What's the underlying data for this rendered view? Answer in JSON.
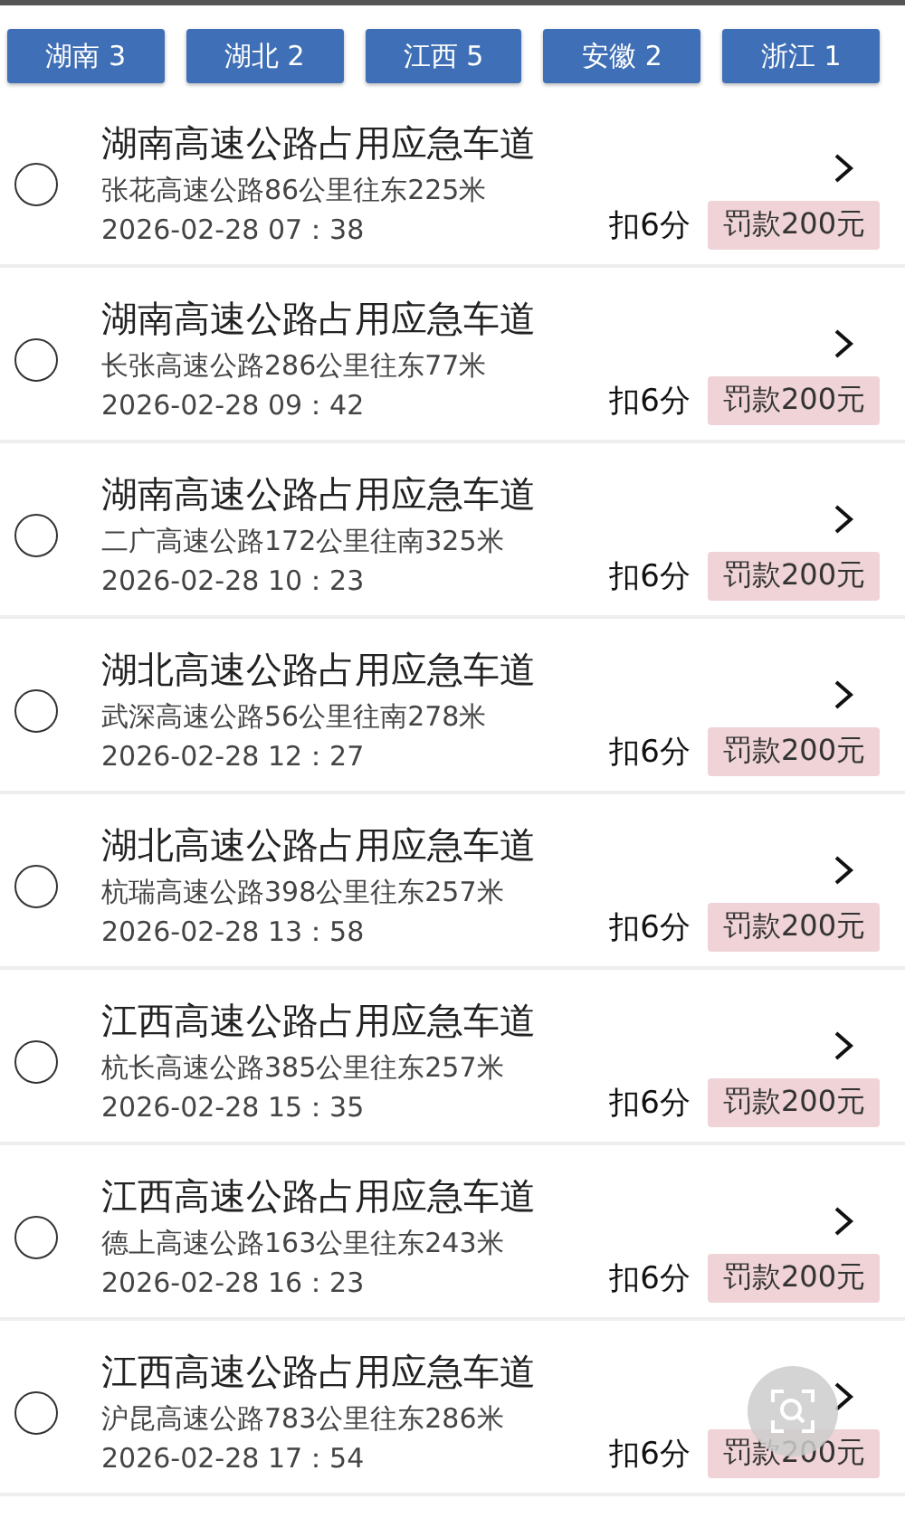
{
  "tabs": [
    {
      "label": "湖南 3"
    },
    {
      "label": "湖北 2"
    },
    {
      "label": "江西 5"
    },
    {
      "label": "安徽 2"
    },
    {
      "label": "浙江 1"
    }
  ],
  "violations": [
    {
      "title": "湖南高速公路占用应急车道",
      "location": "张花高速公路86公里往东225米",
      "time": "2026-02-28  07：38",
      "points": "扣6分",
      "fine": "罚款200元",
      "selected": false
    },
    {
      "title": "湖南高速公路占用应急车道",
      "location": "长张高速公路286公里往东77米",
      "time": "2026-02-28  09：42",
      "points": "扣6分",
      "fine": "罚款200元",
      "selected": false
    },
    {
      "title": "湖南高速公路占用应急车道",
      "location": "二广高速公路172公里往南325米",
      "time": "2026-02-28  10：23",
      "points": "扣6分",
      "fine": "罚款200元",
      "selected": false
    },
    {
      "title": "湖北高速公路占用应急车道",
      "location": "武深高速公路56公里往南278米",
      "time": "2026-02-28  12：27",
      "points": "扣6分",
      "fine": "罚款200元",
      "selected": false
    },
    {
      "title": "湖北高速公路占用应急车道",
      "location": "杭瑞高速公路398公里往东257米",
      "time": "2026-02-28  13：58",
      "points": "扣6分",
      "fine": "罚款200元",
      "selected": false
    },
    {
      "title": "江西高速公路占用应急车道",
      "location": "杭长高速公路385公里往东257米",
      "time": "2026-02-28  15：35",
      "points": "扣6分",
      "fine": "罚款200元",
      "selected": false
    },
    {
      "title": "江西高速公路占用应急车道",
      "location": "德上高速公路163公里往东243米",
      "time": "2026-02-28  16：23",
      "points": "扣6分",
      "fine": "罚款200元",
      "selected": false
    },
    {
      "title": "江西高速公路占用应急车道",
      "location": "沪昆高速公路783公里往东286米",
      "time": "2026-02-28  17：54",
      "points": "扣6分",
      "fine": "罚款200元",
      "selected": false
    }
  ]
}
